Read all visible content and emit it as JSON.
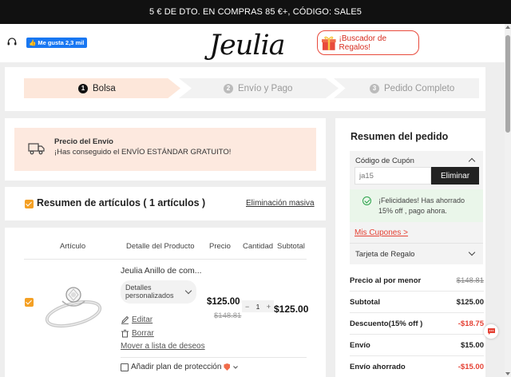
{
  "promo_bar": {
    "text": "5 € DE DTO. EN COMPRAS 85 €+, CÓDIGO: SALE5"
  },
  "header": {
    "fb_like": "Me gusta 2,3 mil",
    "logo": "Jeulia",
    "gift_finder": "¡Buscador de Regalos!",
    "icons": [
      "support-icon",
      "search-icon",
      "account-icon",
      "wishlist-heart-icon",
      "globe-icon"
    ]
  },
  "steps": [
    {
      "num": "1",
      "label": "Bolsa",
      "active": true
    },
    {
      "num": "2",
      "label": "Envío y Pago",
      "active": false
    },
    {
      "num": "3",
      "label": "Pedido Completo",
      "active": false
    }
  ],
  "shipping": {
    "title": "Precio del Envío",
    "text": "¡Has conseguido el ENVÍO ESTÁNDAR GRATUITO!"
  },
  "items_summary": {
    "title": "Resumen de artículos ( 1 artículos )",
    "mass_delete": "Eliminación masiva"
  },
  "table": {
    "headers": {
      "article": "Artículo",
      "detail": "Detalle del Producto",
      "price": "Precio",
      "qty": "Cantidad",
      "subtotal": "Subtotal"
    }
  },
  "item": {
    "name": "Jeulia Anillo de com...",
    "details_select": "Detalles personalizados",
    "edit": "Editar",
    "delete": "Borrar",
    "move_wishlist": "Mover a lista de deseos",
    "price": "$125.00",
    "old_price": "$148.81",
    "qty_minus": "−",
    "qty": "1",
    "qty_plus": "+",
    "subtotal": "$125.00",
    "protection": "Añadir plan de protección"
  },
  "order_summary": {
    "title": "Resumen del pedido",
    "coupon_label": "Código de Cupón",
    "coupon_value": "ja15",
    "coupon_button": "Eliminar",
    "success_text": "¡Felicidades! Has ahorrado 15% off , pago ahora.",
    "my_coupons": "Mis Cupones >",
    "gift_card": "Tarjeta de Regalo",
    "rows": [
      {
        "label": "Precio al por menor",
        "value": "$148.81",
        "style": "strike"
      },
      {
        "label": "Subtotal",
        "value": "$125.00",
        "style": "normal"
      },
      {
        "label": "Descuento(15% off )",
        "value": "-$18.75",
        "style": "red"
      },
      {
        "label": "Envío",
        "value": "$15.00",
        "style": "normal"
      },
      {
        "label": "Envío ahorrado",
        "value": "-$15.00",
        "style": "red"
      }
    ]
  },
  "colors": {
    "accent": "#f4a024",
    "red": "#e54235",
    "step_active": "#fde7da",
    "success_bg": "#eaf6ea"
  }
}
